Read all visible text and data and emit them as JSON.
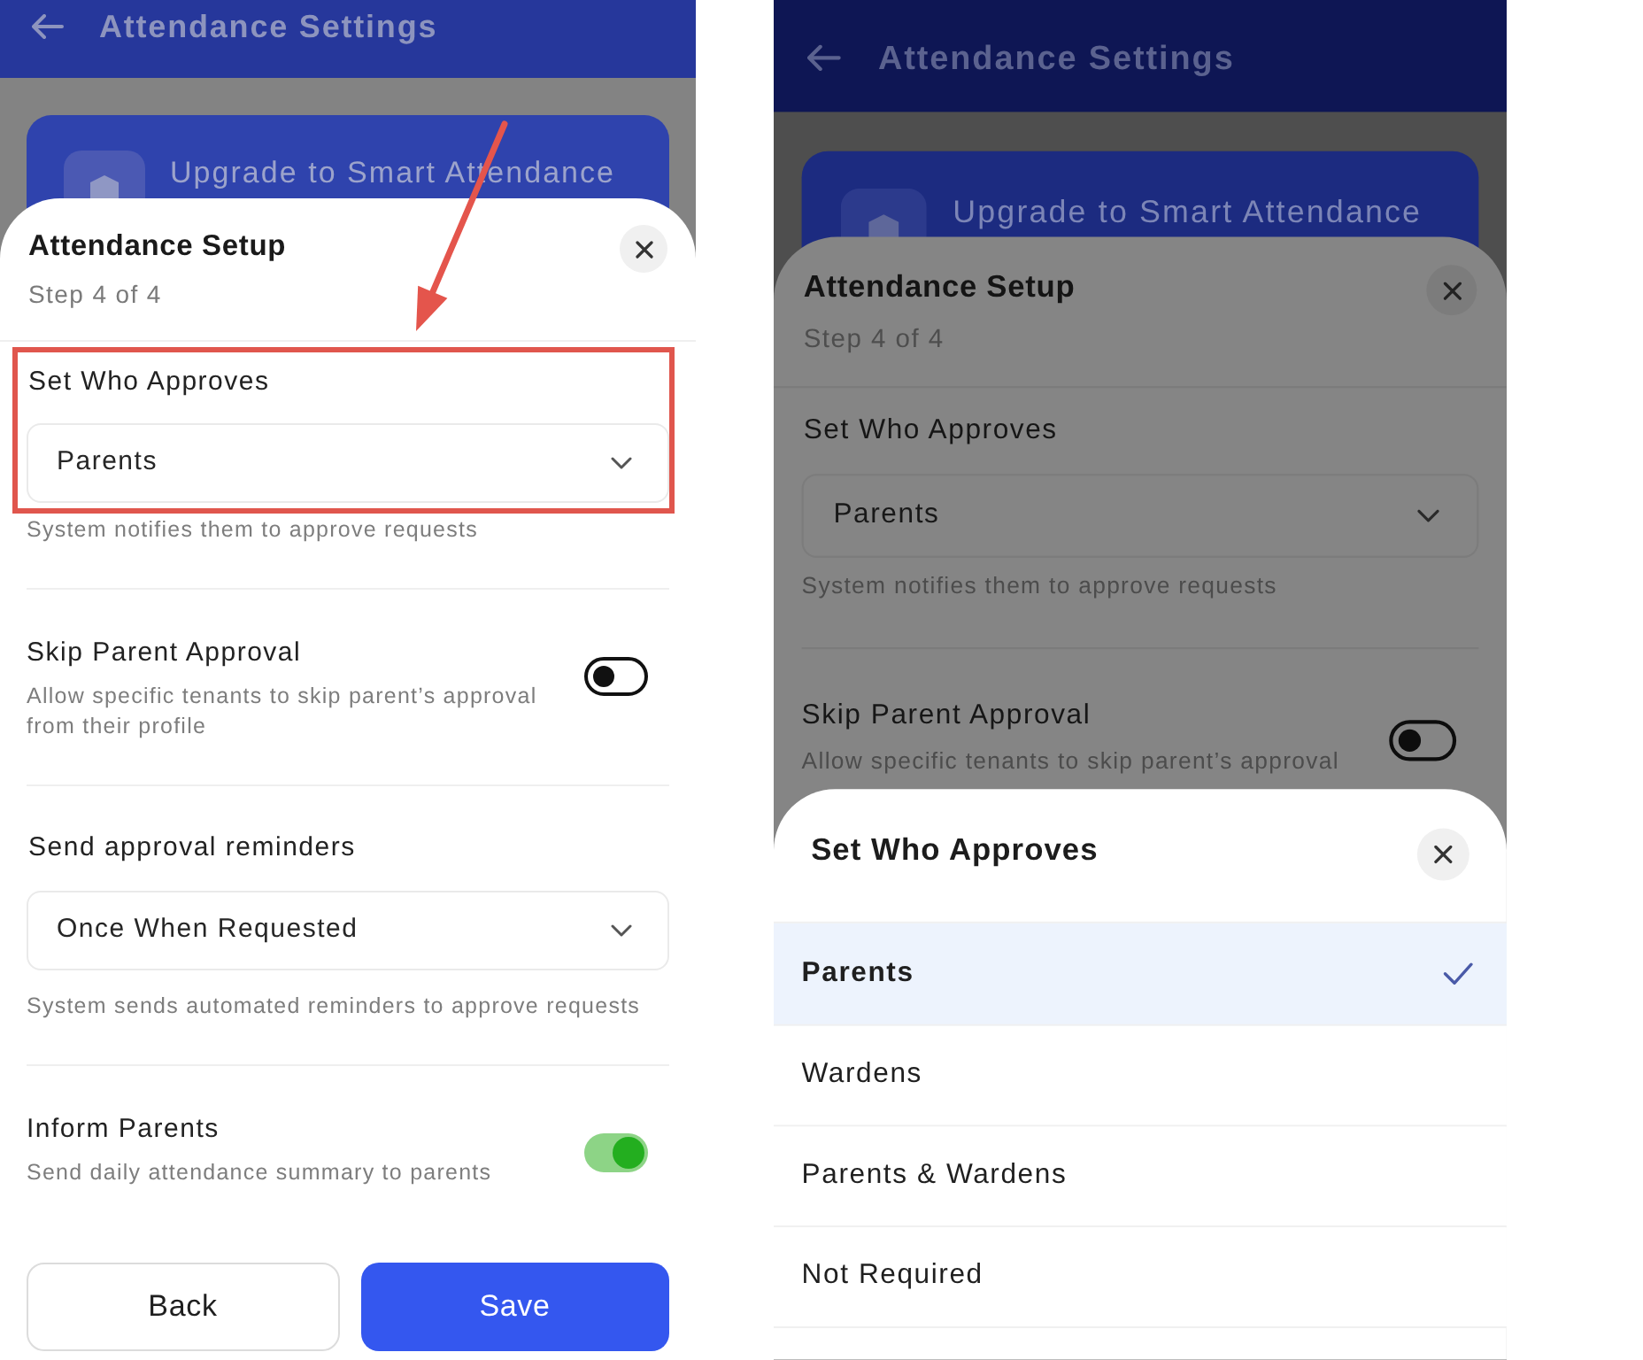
{
  "screens": [
    {
      "header": {
        "title": "Attendance Settings"
      },
      "banner": {
        "title": "Upgrade to Smart Attendance"
      },
      "sheets": [
        {
          "kind": "form",
          "title": "Attendance Setup",
          "subtitle": "Step 4 of 4",
          "sections": [
            {
              "kind": "select",
              "label": "Set Who Approves",
              "value": "Parents",
              "hint": "System notifies them to approve requests",
              "highlighted": true
            },
            {
              "kind": "toggle",
              "label": "Skip Parent Approval",
              "description": "Allow specific tenants to skip parent’s approval from their profile",
              "on": false,
              "highlighted": false
            },
            {
              "kind": "select",
              "label": "Send approval reminders",
              "value": "Once When Requested",
              "hint": "System sends automated reminders to approve requests",
              "highlighted": false
            },
            {
              "kind": "toggle",
              "label": "Inform Parents",
              "description": "Send daily attendance summary to parents",
              "on": true,
              "highlighted": false
            }
          ],
          "buttons": [
            {
              "label": "Back",
              "kind": "back"
            },
            {
              "label": "Save",
              "kind": "save"
            }
          ]
        }
      ]
    },
    {
      "header": {
        "title": "Attendance Settings"
      },
      "banner": {
        "title": "Upgrade to Smart Attendance"
      },
      "sheets": [
        {
          "kind": "form",
          "title": "Attendance Setup",
          "subtitle": "Step 4 of 4",
          "sections": [
            {
              "kind": "select",
              "label": "Set Who Approves",
              "value": "Parents",
              "hint": "System notifies them to approve requests",
              "highlighted": false
            },
            {
              "kind": "toggle",
              "label": "Skip Parent Approval",
              "description": "Allow specific tenants to skip parent’s approval",
              "on": false,
              "highlighted": false
            }
          ]
        },
        {
          "kind": "picker",
          "title": "Set Who Approves",
          "options": [
            {
              "label": "Parents",
              "selected": true
            },
            {
              "label": "Wardens",
              "selected": false
            },
            {
              "label": "Parents & Wardens",
              "selected": false
            },
            {
              "label": "Not Required",
              "selected": false
            }
          ]
        }
      ]
    }
  ]
}
